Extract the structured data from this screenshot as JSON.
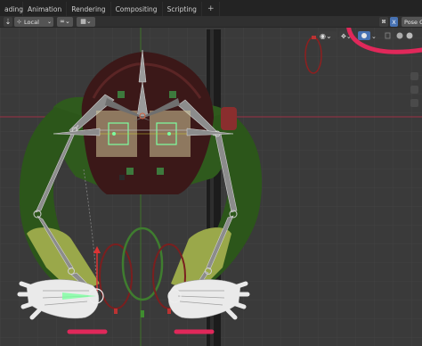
{
  "workspace_tabs": [
    {
      "label": "ading"
    },
    {
      "label": "Animation"
    },
    {
      "label": "Rendering"
    },
    {
      "label": "Compositing"
    },
    {
      "label": "Scripting"
    }
  ],
  "add_workspace_label": "+",
  "header": {
    "transform_orientation": "Local",
    "x_axis_label": "X",
    "pose_mode_label": "Pose C"
  },
  "icons": {
    "transform_pivot": "pivot-icon",
    "snap": "magnet-icon",
    "proportional": "grid-snap-icon",
    "visibility": "eye-icon",
    "gizmo": "gizmo-icon",
    "overlay": "overlay-icon",
    "xray": "xray-icon"
  },
  "colors": {
    "annotation": "#e0285a",
    "bone_gray": "#8c8c8c",
    "bone_green": "#7dffa0",
    "character_green": "#2f5a1d",
    "hair": "#3b1818",
    "active_axis": "#4772b3"
  }
}
